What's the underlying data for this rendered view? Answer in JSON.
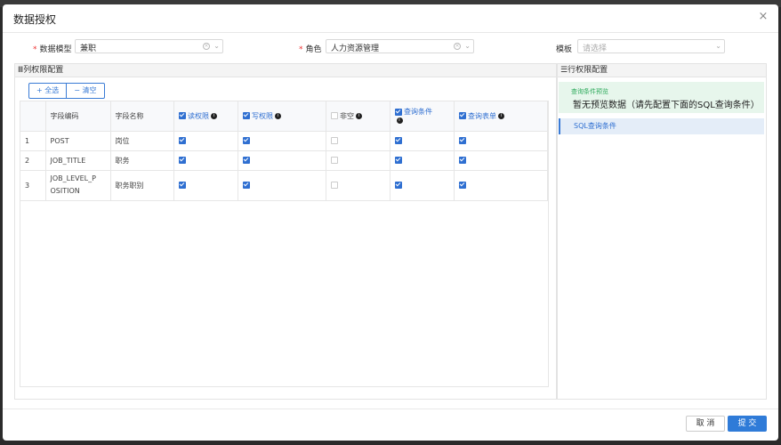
{
  "dialog": {
    "title": "数据授权",
    "close_icon": "×"
  },
  "form": {
    "model": {
      "label": "数据模型",
      "value": "兼职"
    },
    "role": {
      "label": "角色",
      "value": "人力资源管理"
    },
    "template": {
      "label": "模板",
      "placeholder": "请选择"
    },
    "clear_icon": "×",
    "chevron_icon": "⌄",
    "required_mark": "*"
  },
  "column_panel": {
    "title": "Ⅲ列权限配置",
    "select_all": "+ 全选",
    "clear": "− 清空",
    "headers": {
      "code": "字段编码",
      "name": "字段名称",
      "read": "读权限",
      "write": "写权限",
      "nonnull": "非空",
      "query": "查询条件",
      "form": "查询表单"
    },
    "info_icon": "i",
    "rows": [
      {
        "index": "1",
        "code": "POST",
        "name": "岗位",
        "read": true,
        "write": true,
        "nonnull": false,
        "query": true,
        "form": true
      },
      {
        "index": "2",
        "code": "JOB_TITLE",
        "name": "职务",
        "read": true,
        "write": true,
        "nonnull": false,
        "query": true,
        "form": true
      },
      {
        "index": "3",
        "code": "JOB_LEVEL_P\nOSITION",
        "name": "职务职别",
        "read": true,
        "write": true,
        "nonnull": false,
        "query": true,
        "form": true
      }
    ]
  },
  "row_panel": {
    "title": "☰行权限配置",
    "preview_label": "查询条件预览",
    "preview_message": "暂无预览数据（请先配置下面的SQL查询条件）",
    "sql_item": "SQL查询条件"
  },
  "footer": {
    "cancel": "取 消",
    "submit": "提 交"
  },
  "colors": {
    "accent": "#2f6fd1",
    "submit_bg": "#2f7bd8",
    "preview_bg": "#e7f6ec",
    "required": "#e33333"
  }
}
